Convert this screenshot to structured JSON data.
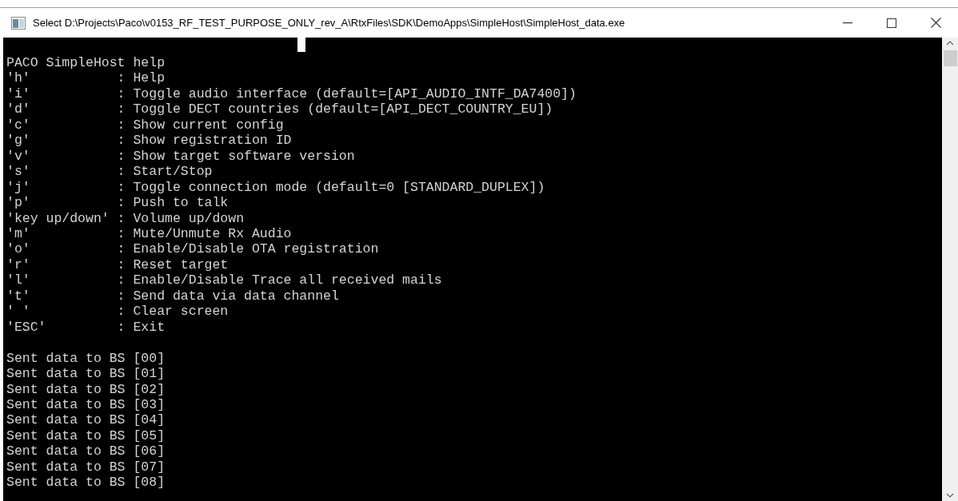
{
  "window": {
    "title": "Select D:\\Projects\\Paco\\v0153_RF_TEST_PURPOSE_ONLY_rev_A\\RtxFiles\\SDK\\DemoApps\\SimpleHost\\SimpleHost_data.exe"
  },
  "console": {
    "lines": [
      "PACO SimpleHost help",
      "'h'           : Help",
      "'i'           : Toggle audio interface (default=[API_AUDIO_INTF_DA7400])",
      "'d'           : Toggle DECT countries (default=[API_DECT_COUNTRY_EU])",
      "'c'           : Show current config",
      "'g'           : Show registration ID",
      "'v'           : Show target software version",
      "'s'           : Start/Stop",
      "'j'           : Toggle connection mode (default=0 [STANDARD_DUPLEX])",
      "'p'           : Push to talk",
      "'key up/down' : Volume up/down",
      "'m'           : Mute/Unmute Rx Audio",
      "'o'           : Enable/Disable OTA registration",
      "'r'           : Reset target",
      "'l'           : Enable/Disable Trace all received mails",
      "'t'           : Send data via data channel",
      "' '           : Clear screen",
      "'ESC'         : Exit"
    ],
    "log_lines": [
      "Sent data to BS [00]",
      "Sent data to BS [01]",
      "Sent data to BS [02]",
      "Sent data to BS [03]",
      "Sent data to BS [04]",
      "Sent data to BS [05]",
      "Sent data to BS [06]",
      "Sent data to BS [07]",
      "Sent data to BS [08]"
    ]
  }
}
